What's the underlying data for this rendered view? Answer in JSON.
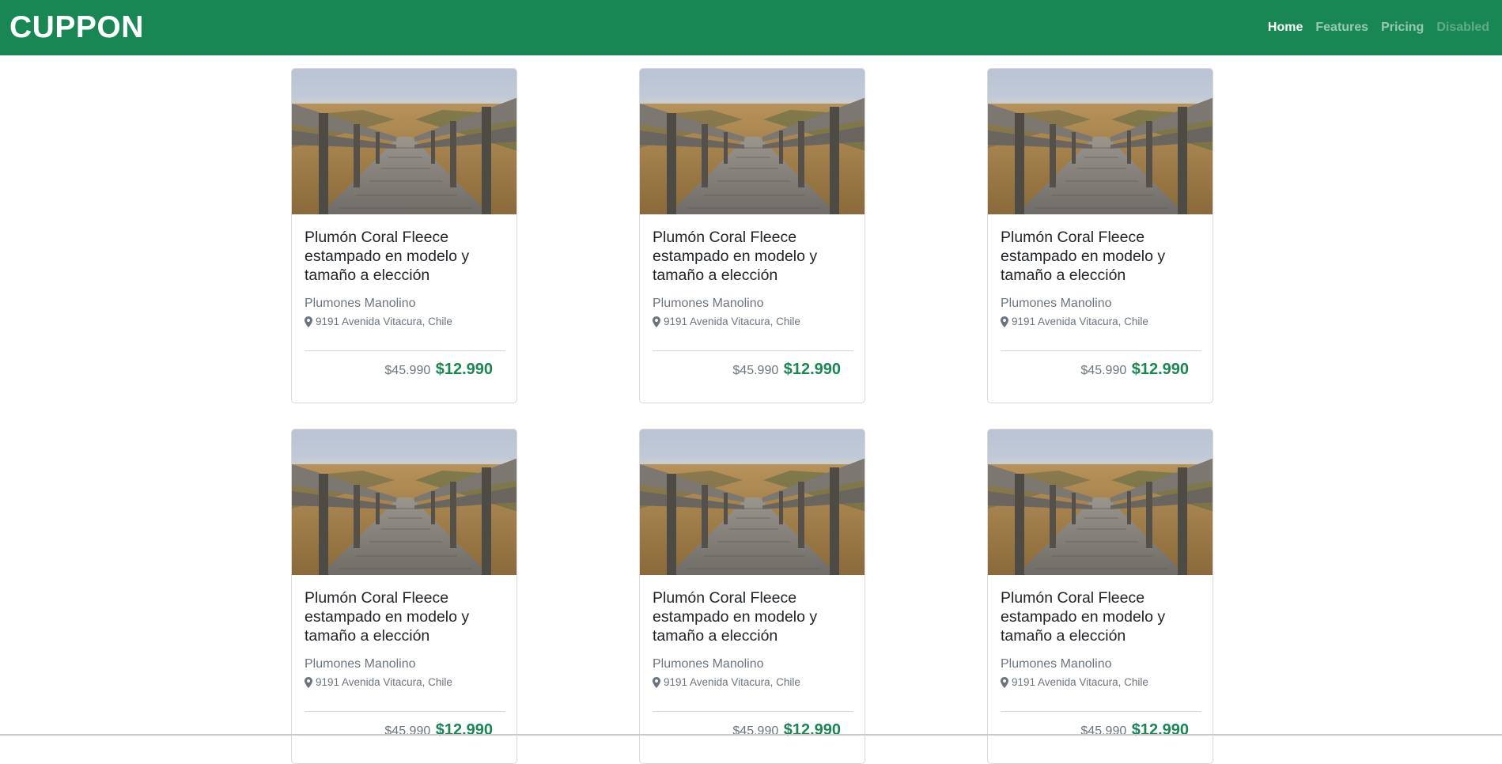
{
  "navbar": {
    "brand": "CUPPON",
    "links": [
      {
        "label": "Home",
        "state": "active"
      },
      {
        "label": "Features",
        "state": "normal"
      },
      {
        "label": "Pricing",
        "state": "normal"
      },
      {
        "label": "Disabled",
        "state": "disabled"
      }
    ]
  },
  "colors": {
    "brand_green": "#198754",
    "muted_text": "#6c757d"
  },
  "cards": [
    {
      "image": "wooden-boardwalk-photo",
      "title": "Plumón Coral Fleece estampado en modelo y tamaño a elección",
      "company": "Plumones Manolino",
      "address": "9191 Avenida Vitacura, Chile",
      "old_price": "$45.990",
      "price": "$12.990"
    },
    {
      "image": "wooden-boardwalk-photo",
      "title": "Plumón Coral Fleece estampado en modelo y tamaño a elección",
      "company": "Plumones Manolino",
      "address": "9191 Avenida Vitacura, Chile",
      "old_price": "$45.990",
      "price": "$12.990"
    },
    {
      "image": "wooden-boardwalk-photo",
      "title": "Plumón Coral Fleece estampado en modelo y tamaño a elección",
      "company": "Plumones Manolino",
      "address": "9191 Avenida Vitacura, Chile",
      "old_price": "$45.990",
      "price": "$12.990"
    },
    {
      "image": "wooden-boardwalk-photo",
      "title": "Plumón Coral Fleece estampado en modelo y tamaño a elección",
      "company": "Plumones Manolino",
      "address": "9191 Avenida Vitacura, Chile",
      "old_price": "$45.990",
      "price": "$12.990"
    },
    {
      "image": "wooden-boardwalk-photo",
      "title": "Plumón Coral Fleece estampado en modelo y tamaño a elección",
      "company": "Plumones Manolino",
      "address": "9191 Avenida Vitacura, Chile",
      "old_price": "$45.990",
      "price": "$12.990"
    },
    {
      "image": "wooden-boardwalk-photo",
      "title": "Plumón Coral Fleece estampado en modelo y tamaño a elección",
      "company": "Plumones Manolino",
      "address": "9191 Avenida Vitacura, Chile",
      "old_price": "$45.990",
      "price": "$12.990"
    }
  ]
}
